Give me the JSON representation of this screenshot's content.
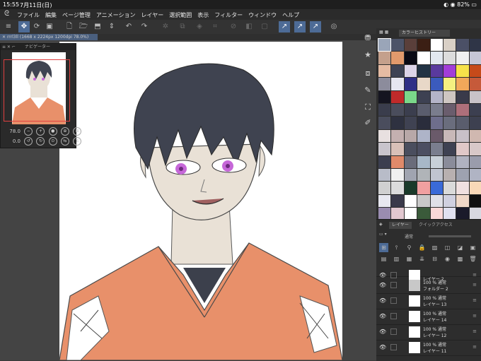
{
  "status_bar": {
    "time": "15:55",
    "date": "7月11日(日)",
    "battery": "82%"
  },
  "menu": {
    "items": [
      "ファイル",
      "編集",
      "ページ管理",
      "アニメーション",
      "レイヤー",
      "選択範囲",
      "表示",
      "フィルター",
      "ウィンドウ",
      "ヘルプ"
    ]
  },
  "canvas_tab": {
    "label": "rrrl3ll  (1668 x 2224px 1200dpi 78.0%)"
  },
  "navigator": {
    "title": "ナビゲーター",
    "zoom_value": "78.0",
    "rotation_value": "0.0"
  },
  "color_panel": {
    "tab_label": "カラーヒストリー",
    "swatches": [
      "#9aa5b8",
      "#4c5368",
      "#5a3f3a",
      "#3b1f14",
      "#ffffff",
      "#d9d0c6",
      "#4b5066",
      "#2f3547",
      "#c4a08c",
      "#e29a6c",
      "#0a0a14",
      "#ffffff",
      "#e2e8f0",
      "#dcdcdc",
      "#f0f0f0",
      "#c6c6d6",
      "#e5bba3",
      "#3e4354",
      "#dcd4e8",
      "#223344",
      "#5a3a9e",
      "#a23dd8",
      "#f7e24a",
      "#c64a1a",
      "#8c8c9c",
      "#e6e6f0",
      "#2f2f86",
      "#e8d8c8",
      "#3b5bbd",
      "#f4f080",
      "#f2a85a",
      "#c65a3a",
      "#151520",
      "#c02a2a",
      "#7ad88a",
      "#3d4152",
      "#b4b4c8",
      "#cfc6c2",
      "#3a3a4a",
      "#c8c2c8",
      "#3a3d4c",
      "#4a4d5c",
      "#3b3e4e",
      "#5a5d6d",
      "#7a7d8d",
      "#6a5d6d",
      "#ae6f7a",
      "#3c3f50",
      "#4a4d5d",
      "#2e3140",
      "#3f4252",
      "#2a2d3c",
      "#6e6e8c",
      "#6a6d7d",
      "#5a5d6d",
      "#3d4050",
      "#e8e0e0",
      "#c4b0b0",
      "#b8a8a8",
      "#aeb4c8",
      "#6a5a6a",
      "#c8b8b8",
      "#c8c0c8",
      "#d0b8b0",
      "#c8c4cc",
      "#d8c0b8",
      "#4a4e5e",
      "#4c4f62",
      "#7a7e8e",
      "#3e4152",
      "#e0c8c8",
      "#d8c8c8",
      "#3b3e4f",
      "#e08a6a",
      "#6a6c7a",
      "#a8b8c8",
      "#c8d0d8",
      "#8a8c9a",
      "#b0b2c0",
      "#9a9cac",
      "#b8bcc8",
      "#f0f0f0",
      "#a0a4b0",
      "#b0b4b8",
      "#c0c4d0",
      "#b8b0b0",
      "#9ea2b0",
      "#b0b4c4",
      "#d0d0d0",
      "#dcdcdc",
      "#1a3a2a",
      "#f0a0a0",
      "#3a6ad8",
      "#dadada",
      "#f0e0e0",
      "#f8d8b8",
      "#e8e8f0",
      "#3a3a4a",
      "#ffffff",
      "#c8c8c8",
      "#e0e0e8",
      "#d0d0e0",
      "#f0d8c8",
      "#101010",
      "#9a8cb0",
      "#e2c8d0",
      "#ffffff",
      "#3a5a3a",
      "#fad8d8",
      "#e0e0f0",
      "#1a1a2a",
      "#d8d8e0",
      "#f4f4f4",
      "#4b4f60",
      "#f8f8f8",
      "#e8e0d0",
      "#5a7ad0",
      "#f0a050",
      "#c8b098",
      "#d0c8c0"
    ]
  },
  "layer_panel": {
    "tab_layer": "レイヤー",
    "tab_quick": "クイックアクセス",
    "blend_mode": "通常",
    "layers": [
      {
        "opacity": "",
        "name": "レイヤー 2",
        "partial": true
      },
      {
        "opacity": "100 %  通常",
        "name": "フォルダー 2",
        "folder": true
      },
      {
        "opacity": "100 %  通常",
        "name": "レイヤー 13"
      },
      {
        "opacity": "100 %  通常",
        "name": "レイヤー 14"
      },
      {
        "opacity": "100 %  通常",
        "name": "レイヤー 12"
      },
      {
        "opacity": "100 %  通常",
        "name": "レイヤー 11"
      }
    ]
  },
  "colors": {
    "skin": "#e9e1d6",
    "hair": "#3f4350",
    "kimono": "#e8906a",
    "eyes": "#c667d8",
    "accent": "#4d6b96"
  }
}
